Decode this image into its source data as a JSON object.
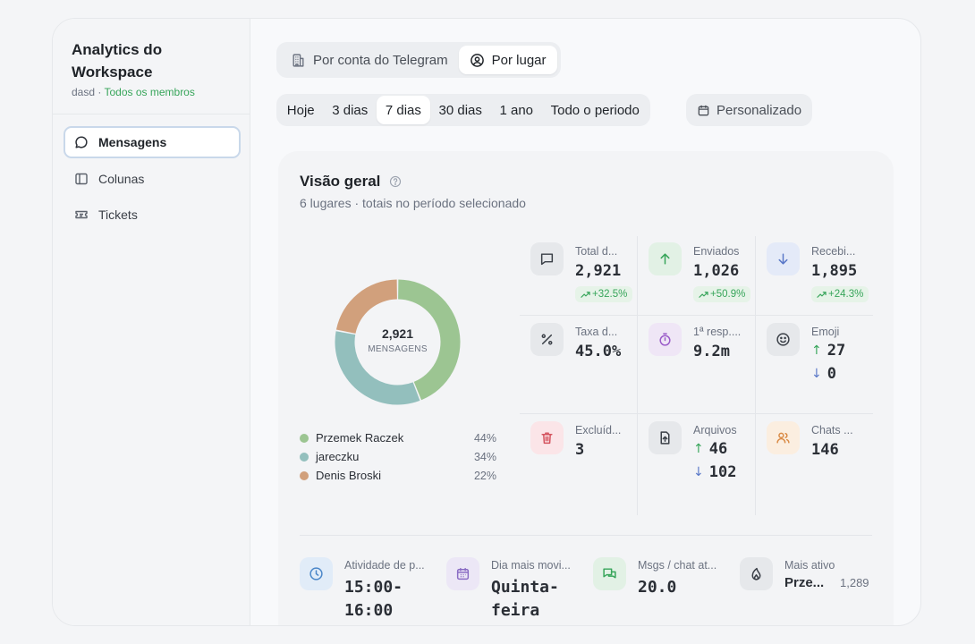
{
  "sidebar": {
    "title": "Analytics do Workspace",
    "subtitle_user": "dasd",
    "subtitle_sep": " · ",
    "subtitle_scope": "Todos os membros",
    "items": [
      {
        "label": "Mensagens",
        "icon": "message-icon",
        "active": true
      },
      {
        "label": "Colunas",
        "icon": "columns-icon",
        "active": false
      },
      {
        "label": "Tickets",
        "icon": "ticket-icon",
        "active": false
      }
    ]
  },
  "view_toggle": {
    "options": [
      {
        "label": "Por conta do Telegram",
        "icon": "building-icon",
        "active": false
      },
      {
        "label": "Por lugar",
        "icon": "user-circle-icon",
        "active": true
      }
    ]
  },
  "periods": {
    "options": [
      "Hoje",
      "3 dias",
      "7 dias",
      "30 dias",
      "1 ano",
      "Todo o periodo"
    ],
    "active": "7 dias",
    "custom_label": "Personalizado"
  },
  "overview": {
    "title": "Visão geral",
    "subtitle": "6 lugares · totais no período selecionado",
    "donut": {
      "total": "2,921",
      "label": "MENSAGENS"
    },
    "legend": [
      {
        "name": "Przemek Raczek",
        "pct": "44%",
        "color": "#9cc592"
      },
      {
        "name": "jareczku",
        "pct": "34%",
        "color": "#93bfbd"
      },
      {
        "name": "Denis Broski",
        "pct": "22%",
        "color": "#d1a07c"
      }
    ],
    "metrics": {
      "total": {
        "label": "Total d...",
        "value": "2,921",
        "change": "+32.5%"
      },
      "sent": {
        "label": "Enviados",
        "value": "1,026",
        "change": "+50.9%"
      },
      "received": {
        "label": "Recebi...",
        "value": "1,895",
        "change": "+24.3%"
      },
      "rate": {
        "label": "Taxa d...",
        "value": "45.0%"
      },
      "first_response": {
        "label": "1ª resp....",
        "value": "9.2m"
      },
      "emoji": {
        "label": "Emoji",
        "up": "27",
        "down": "0"
      },
      "deleted": {
        "label": "Excluíd...",
        "value": "3"
      },
      "files": {
        "label": "Arquivos",
        "up": "46",
        "down": "102"
      },
      "chats": {
        "label": "Chats ...",
        "value": "146"
      }
    },
    "bottom": {
      "peak_activity": {
        "label": "Atividade de p...",
        "value": "15:00-16:00"
      },
      "busiest_day": {
        "label": "Dia mais movi...",
        "value": "Quinta-feira"
      },
      "msgs_per_chat": {
        "label": "Msgs / chat at...",
        "value": "20.0"
      },
      "most_active": {
        "label": "Mais ativo",
        "name": "Prze...",
        "count": "1,289"
      }
    }
  },
  "chart_data": {
    "type": "pie",
    "categories": [
      "Przemek Raczek",
      "jareczku",
      "Denis Broski"
    ],
    "values": [
      44,
      34,
      22
    ],
    "colors": [
      "#9cc592",
      "#93bfbd",
      "#d1a07c"
    ],
    "title": "",
    "center_value": "2,921",
    "center_label": "MENSAGENS"
  }
}
